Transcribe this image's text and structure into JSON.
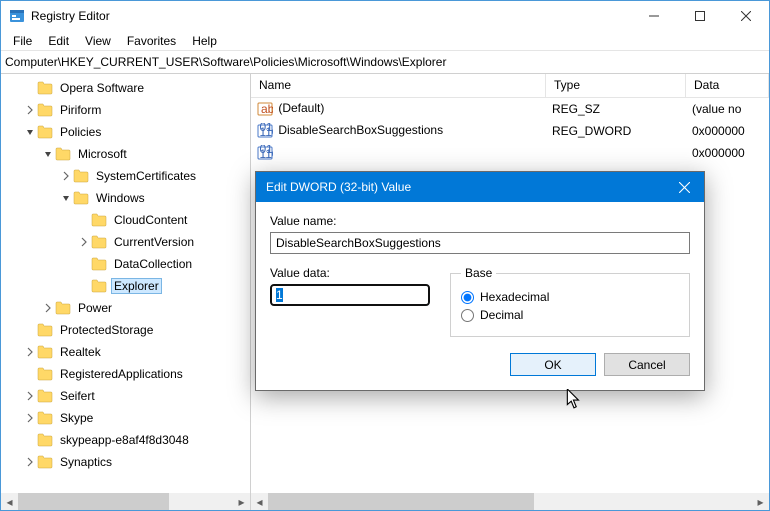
{
  "window": {
    "title": "Registry Editor"
  },
  "menu": {
    "file": "File",
    "edit": "Edit",
    "view": "View",
    "favorites": "Favorites",
    "help": "Help"
  },
  "address": {
    "path": "Computer\\HKEY_CURRENT_USER\\Software\\Policies\\Microsoft\\Windows\\Explorer"
  },
  "tree": {
    "items": [
      {
        "label": "Opera Software",
        "indent": 1,
        "twisty": ""
      },
      {
        "label": "Piriform",
        "indent": 1,
        "twisty": ">"
      },
      {
        "label": "Policies",
        "indent": 1,
        "twisty": "v"
      },
      {
        "label": "Microsoft",
        "indent": 2,
        "twisty": "v"
      },
      {
        "label": "SystemCertificates",
        "indent": 3,
        "twisty": ">"
      },
      {
        "label": "Windows",
        "indent": 3,
        "twisty": "v"
      },
      {
        "label": "CloudContent",
        "indent": 4,
        "twisty": ""
      },
      {
        "label": "CurrentVersion",
        "indent": 4,
        "twisty": ">"
      },
      {
        "label": "DataCollection",
        "indent": 4,
        "twisty": ""
      },
      {
        "label": "Explorer",
        "indent": 4,
        "twisty": "",
        "selected": true
      },
      {
        "label": "Power",
        "indent": 2,
        "twisty": ">"
      },
      {
        "label": "ProtectedStorage",
        "indent": 1,
        "twisty": ""
      },
      {
        "label": "Realtek",
        "indent": 1,
        "twisty": ">"
      },
      {
        "label": "RegisteredApplications",
        "indent": 1,
        "twisty": ""
      },
      {
        "label": "Seifert",
        "indent": 1,
        "twisty": ">"
      },
      {
        "label": "Skype",
        "indent": 1,
        "twisty": ">"
      },
      {
        "label": "skypeapp-e8af4f8d3048",
        "indent": 1,
        "twisty": ""
      },
      {
        "label": "Synaptics",
        "indent": 1,
        "twisty": ">"
      }
    ]
  },
  "list": {
    "columns": {
      "name": "Name",
      "type": "Type",
      "data": "Data"
    },
    "rows": [
      {
        "icon": "string",
        "name": "(Default)",
        "type": "REG_SZ",
        "data": "(value no"
      },
      {
        "icon": "binary",
        "name": "DisableSearchBoxSuggestions",
        "type": "REG_DWORD",
        "data": "0x000000"
      },
      {
        "icon": "binary",
        "name": "",
        "type": "",
        "data": "0x000000"
      }
    ]
  },
  "dialog": {
    "title": "Edit DWORD (32-bit) Value",
    "valueNameLabel": "Value name:",
    "valueName": "DisableSearchBoxSuggestions",
    "valueDataLabel": "Value data:",
    "valueData": "1",
    "baseLabel": "Base",
    "hexLabel": "Hexadecimal",
    "decLabel": "Decimal",
    "ok": "OK",
    "cancel": "Cancel"
  }
}
